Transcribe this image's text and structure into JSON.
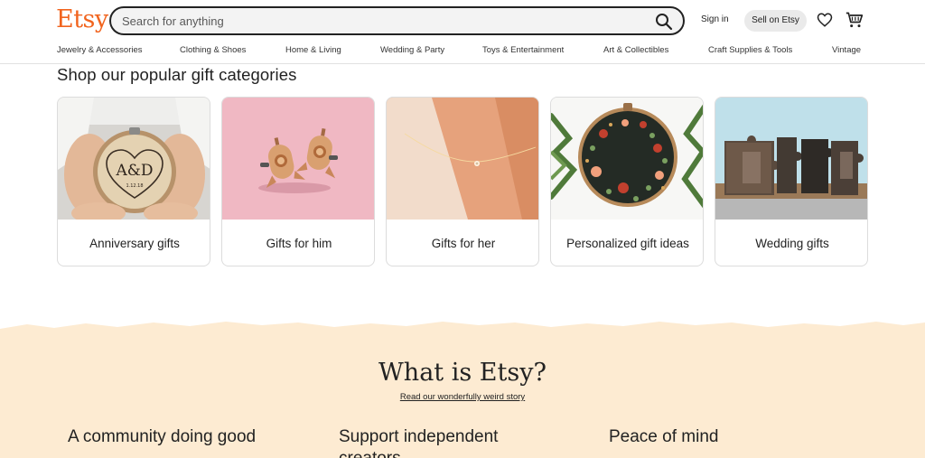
{
  "header": {
    "logo": "Etsy",
    "search_placeholder": "Search for anything",
    "sign_in": "Sign in",
    "sell": "Sell on Etsy"
  },
  "nav": [
    "Jewelry & Accessories",
    "Clothing & Shoes",
    "Home & Living",
    "Wedding & Party",
    "Toys & Entertainment",
    "Art & Collectibles",
    "Craft Supplies & Tools",
    "Vintage"
  ],
  "gifts": {
    "title": "Shop our popular gift categories",
    "cards": [
      {
        "label": "Anniversary gifts",
        "engraving": "A&D",
        "date": "1.12.18"
      },
      {
        "label": "Gifts for him"
      },
      {
        "label": "Gifts for her"
      },
      {
        "label": "Personalized gift ideas"
      },
      {
        "label": "Wedding gifts"
      }
    ]
  },
  "what": {
    "title": "What is Etsy?",
    "story_link": "Read our wonderfully weird story",
    "columns": [
      "A community doing good",
      "Support independent creators",
      "Peace of mind"
    ]
  },
  "colors": {
    "brand": "#f1641e",
    "beige": "#fdebd2"
  }
}
